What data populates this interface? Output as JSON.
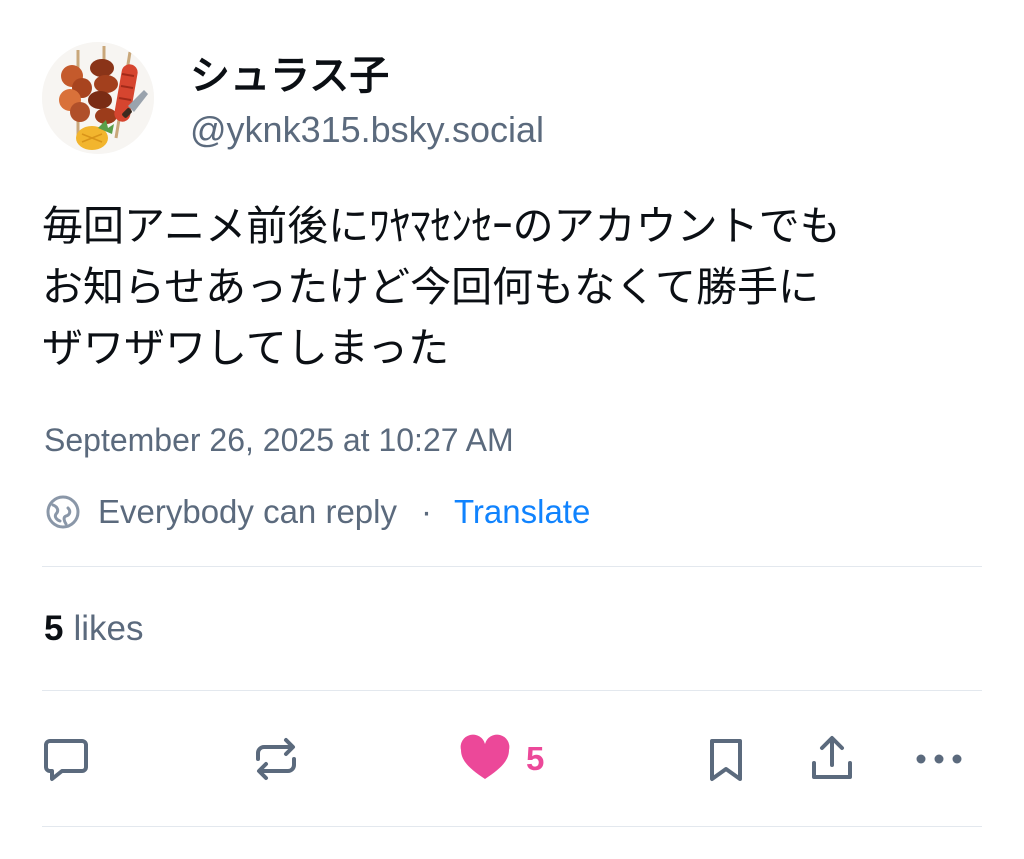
{
  "author": {
    "display_name": "シュラス子",
    "handle": "@yknk315.bsky.social",
    "avatar_icon": "skewers-avatar-icon"
  },
  "post": {
    "text_lines": [
      "毎回アニメ前後にﾜﾔﾏｾﾝｾｰのアカウントでも",
      "お知らせあったけど今回何もなくて勝手に",
      "ザワザワしてしまった"
    ],
    "timestamp": "September 26, 2025 at 10:27 AM"
  },
  "reply_setting": {
    "label": "Everybody can reply",
    "separator": "·",
    "translate_label": "Translate",
    "icon": "globe-icon"
  },
  "stats": {
    "likes_count": "5",
    "likes_label": "likes"
  },
  "actions": {
    "reply_icon": "reply-icon",
    "repost_icon": "repost-icon",
    "like_icon": "heart-icon",
    "like_count": "5",
    "bookmark_icon": "bookmark-icon",
    "share_icon": "share-icon",
    "more_icon": "more-icon"
  },
  "colors": {
    "text": "#0b0f14",
    "muted": "#5b6a7d",
    "link": "#1083fe",
    "like": "#ec4899",
    "divider": "#e3e8ee"
  }
}
